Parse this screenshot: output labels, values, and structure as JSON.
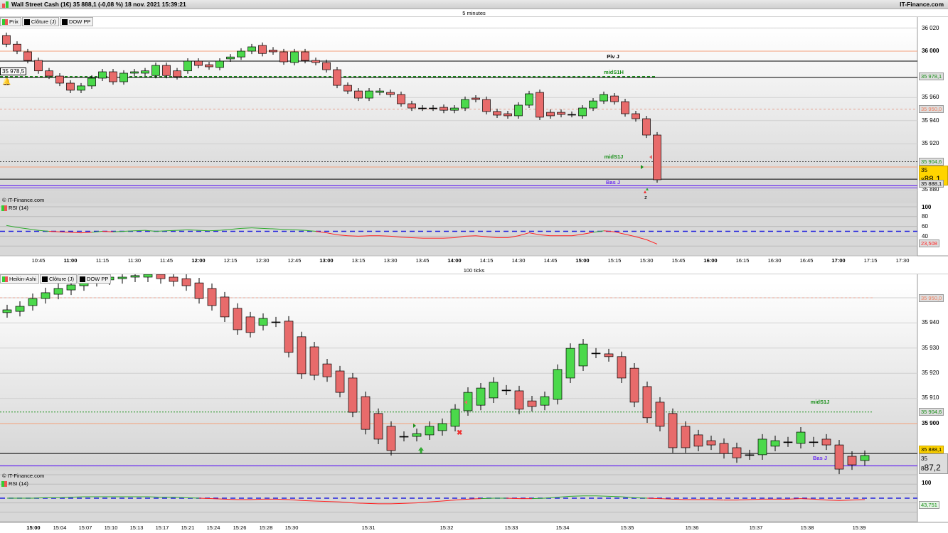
{
  "header": {
    "title": "Wall Street Cash (1€) 35 888,1 (-0,08 %) 18 nov. 2021 15:39:21",
    "brand": "IT-Finance.com"
  },
  "colors": {
    "up": "#4bd94b",
    "down": "#e86b6b",
    "pivot_orange": "#f4a07a",
    "mid_green": "#1a8f1a",
    "bas_purple": "#6a2cf0",
    "rsi_red": "#ff2020",
    "rsi_green": "#2faa2f",
    "rsi_blue": "#2222dd",
    "last_yellow": "#ffd400"
  },
  "top": {
    "period": "5 minutes",
    "tabs": [
      {
        "label": "Prix",
        "icon": "candles-icon"
      },
      {
        "label": "Clôture (J)",
        "icon": "black-square-icon"
      },
      {
        "label": "DOW PP",
        "icon": "black-square-icon"
      }
    ],
    "copyright": "© IT-Finance.com",
    "rsi_label": "RSI (14)",
    "left_price_tag": "35 978,5",
    "y_ticks": [
      "36 020",
      "36 000",
      "35 960",
      "35 940",
      "35 920",
      "35 880"
    ],
    "rsi_ticks": [
      "100",
      "80",
      "60",
      "40"
    ],
    "tags": {
      "midS1H": "35 978,1",
      "pivot_grey": "35 950,0",
      "midS1J": "35 904,6",
      "last": "35 888,1",
      "last_big_a": "35 8",
      "last_big_b": "88,1",
      "rsi": "23,508"
    },
    "levels": {
      "piv": "Piv J",
      "midS1H": "midS1H",
      "midS1J": "midS1J",
      "bas": "Bas J",
      "marker_z": "z"
    },
    "x_ticks": [
      "10:45",
      "11:00",
      "11:15",
      "11:30",
      "11:45",
      "12:00",
      "12:15",
      "12:30",
      "12:45",
      "13:00",
      "13:15",
      "13:30",
      "13:45",
      "14:00",
      "14:15",
      "14:30",
      "14:45",
      "15:00",
      "15:15",
      "15:30",
      "15:45",
      "16:00",
      "16:15",
      "16:30",
      "16:45",
      "17:00",
      "17:15",
      "17:30"
    ],
    "candles": [
      [
        36013.5,
        36006
      ],
      [
        36006,
        36000
      ],
      [
        35999.4,
        35992
      ],
      [
        35992,
        35983
      ],
      [
        35983,
        35978.5
      ],
      [
        35978.5,
        35972.4
      ],
      [
        35972.4,
        35966.3
      ],
      [
        35966.3,
        35970
      ],
      [
        35970,
        35976.7
      ],
      [
        35976.7,
        35982.2
      ],
      [
        35982.2,
        35973.6
      ],
      [
        35973.6,
        35981
      ],
      [
        35981,
        35982.2
      ],
      [
        35981,
        35983
      ],
      [
        35979,
        35987.7
      ],
      [
        35987.7,
        35979
      ],
      [
        35983,
        35978
      ],
      [
        35983,
        35991.4
      ],
      [
        35991.4,
        35987.7
      ],
      [
        35988.3,
        35986.5
      ],
      [
        35985.9,
        35991.4
      ],
      [
        35993.3,
        35995
      ],
      [
        35995,
        36000
      ],
      [
        36000,
        36003.7
      ],
      [
        36005,
        35998
      ],
      [
        36001,
        35999.4
      ],
      [
        35999.4,
        35990.8
      ],
      [
        35990.2,
        35999.4
      ],
      [
        35999.4,
        35992
      ],
      [
        35992,
        35990.2
      ],
      [
        35990.2,
        35984
      ],
      [
        35984,
        35970.5
      ],
      [
        35970.5,
        35965.6
      ],
      [
        35965.6,
        35959.5
      ],
      [
        35959.5,
        35965.6
      ],
      [
        35964.4,
        35965.6
      ],
      [
        35964.4,
        35962.6
      ],
      [
        35962.6,
        35954.6
      ],
      [
        35954.6,
        35950.9
      ],
      [
        35950.9,
        35950.9
      ],
      [
        35950.9,
        35950.9
      ],
      [
        35951.5,
        35949
      ],
      [
        35949,
        35950.9
      ],
      [
        35950.9,
        35958.3
      ],
      [
        35959.5,
        35958.3
      ],
      [
        35958.3,
        35947.9
      ],
      [
        35947.9,
        35944.8
      ],
      [
        35946,
        35944.2
      ],
      [
        35944.2,
        35953.4
      ],
      [
        35953.4,
        35963.2
      ],
      [
        35964.4,
        35943
      ],
      [
        35947.2,
        35944.2
      ],
      [
        35947.2,
        35945.4
      ],
      [
        35945.4,
        35945.4
      ],
      [
        35944.2,
        35950.9
      ],
      [
        35950.9,
        35957
      ],
      [
        35957,
        35962.6
      ],
      [
        35961.3,
        35956.4
      ],
      [
        35956.4,
        35946
      ],
      [
        35946,
        35941.7
      ],
      [
        35941.7,
        35927.6
      ],
      [
        35927.6,
        35889
      ]
    ],
    "rsi": [
      62,
      58,
      55,
      52,
      50,
      49,
      48,
      47,
      48,
      50,
      49,
      50,
      51,
      52,
      50,
      51,
      52,
      53,
      52,
      51,
      52,
      54,
      56,
      57,
      56,
      55,
      54,
      53,
      52,
      50,
      47,
      43,
      41,
      40,
      41,
      41,
      40,
      38,
      37,
      36,
      36,
      36,
      37,
      40,
      41,
      39,
      37,
      37,
      41,
      47,
      43,
      41,
      41,
      41,
      44,
      48,
      51,
      49,
      44,
      39,
      33,
      24
    ]
  },
  "bottom": {
    "period": "100 ticks",
    "tabs": [
      {
        "label": "Heikin-Ashi",
        "icon": "candles-icon"
      },
      {
        "label": "Clôture (J)",
        "icon": "black-square-icon"
      },
      {
        "label": "DOW PP",
        "icon": "black-square-icon"
      }
    ],
    "copyright": "© IT-Finance.com",
    "rsi_label": "RSI (14)",
    "y_ticks": [
      "35 940",
      "35 930",
      "35 920",
      "35 910",
      "35 900"
    ],
    "rsi_ticks": [
      "100"
    ],
    "tags": {
      "pivot_grey": "35 950,0",
      "midS1J": "35 904,6",
      "last": "35 888,1",
      "last_big_a": "35 8",
      "last_big_b": "87,2",
      "rsi": "43,751"
    },
    "levels": {
      "midS1J": "midS1J",
      "bas": "Bas J"
    },
    "x_ticks": [
      "15:00",
      "15:04",
      "15:07",
      "15:10",
      "15:13",
      "15:17",
      "15:21",
      "15:24",
      "15:26",
      "15:28",
      "15:30",
      "15:31",
      "15:32",
      "15:33",
      "15:34",
      "15:35",
      "15:36",
      "15:37",
      "15:38",
      "15:39"
    ],
    "candles": [
      [
        35944.1,
        35945.2
      ],
      [
        35944.6,
        35946.6
      ],
      [
        35946.9,
        35949.7
      ],
      [
        35949.7,
        35952
      ],
      [
        35951.4,
        35953.7
      ],
      [
        35953.1,
        35955.1
      ],
      [
        35954.8,
        35956.5
      ],
      [
        35956.5,
        35957.6
      ],
      [
        35957.1,
        35958.2
      ],
      [
        35957.6,
        35958.2
      ],
      [
        35958.2,
        35958.8
      ],
      [
        35958.2,
        35959.3
      ],
      [
        35959.3,
        35957.6
      ],
      [
        35958.2,
        35956.5
      ],
      [
        35957.6,
        35954.8
      ],
      [
        35955.9,
        35949.7
      ],
      [
        35953.7,
        35946.9
      ],
      [
        35950.3,
        35942.4
      ],
      [
        35945.8,
        35937.3
      ],
      [
        35942.4,
        35936.2
      ],
      [
        35939,
        35941.8
      ],
      [
        35940.4,
        35940.4
      ],
      [
        35940.7,
        35928.3
      ],
      [
        35934.5,
        35919.8
      ],
      [
        35930.5,
        35919.2
      ],
      [
        35923.7,
        35918.6
      ],
      [
        35920.9,
        35912.4
      ],
      [
        35918.1,
        35904.5
      ],
      [
        35910.7,
        35897.7
      ],
      [
        35904,
        35893.8
      ],
      [
        35898.9,
        35889.3
      ],
      [
        35894.9,
        35894.9
      ],
      [
        35894.9,
        35896
      ],
      [
        35895.5,
        35898.9
      ],
      [
        35897.2,
        35900
      ],
      [
        35898.9,
        35905.7
      ],
      [
        35905.1,
        35912.4
      ],
      [
        35907.3,
        35914.1
      ],
      [
        35910.2,
        35916.4
      ],
      [
        35913.3,
        35913.3
      ],
      [
        35913,
        35905.7
      ],
      [
        35909,
        35906.8
      ],
      [
        35907.3,
        35910.7
      ],
      [
        35909.6,
        35921.5
      ],
      [
        35918.1,
        35929.9
      ],
      [
        35922.9,
        35931.6
      ],
      [
        35928,
        35928
      ],
      [
        35927.7,
        35926.6
      ],
      [
        35926.6,
        35918.1
      ],
      [
        35922,
        35908.5
      ],
      [
        35914.7,
        35902.3
      ],
      [
        35908.5,
        35898.9
      ],
      [
        35904,
        35890.4
      ],
      [
        35898.9,
        35890.4
      ],
      [
        35895.5,
        35891
      ],
      [
        35893.2,
        35891.5
      ],
      [
        35892.1,
        35888.1
      ],
      [
        35890.4,
        35886.4
      ],
      [
        35887.6,
        35887.6
      ],
      [
        35887.6,
        35893.8
      ],
      [
        35891,
        35893.2
      ],
      [
        35892.7,
        35892.7
      ],
      [
        35892.1,
        35896.6
      ],
      [
        35892.7,
        35892.7
      ],
      [
        35893.8,
        35891.5
      ],
      [
        35891.5,
        35881.9
      ],
      [
        35887,
        35883.6
      ],
      [
        35885.3,
        35887.3
      ]
    ],
    "rsi": [
      50,
      50,
      50,
      51,
      51,
      52,
      53,
      53,
      53,
      53,
      53,
      53,
      52,
      52,
      51,
      50,
      49,
      48,
      47,
      47,
      48,
      48,
      47,
      45,
      44,
      43,
      42,
      40,
      39,
      38,
      38,
      39,
      40,
      42,
      44,
      46,
      48,
      49,
      50,
      50,
      49,
      49,
      50,
      52,
      54,
      55,
      55,
      54,
      53,
      51,
      50,
      49,
      48,
      47,
      47,
      47,
      46,
      46,
      47,
      48,
      48,
      48,
      49,
      48,
      46,
      45,
      46,
      47
    ]
  }
}
